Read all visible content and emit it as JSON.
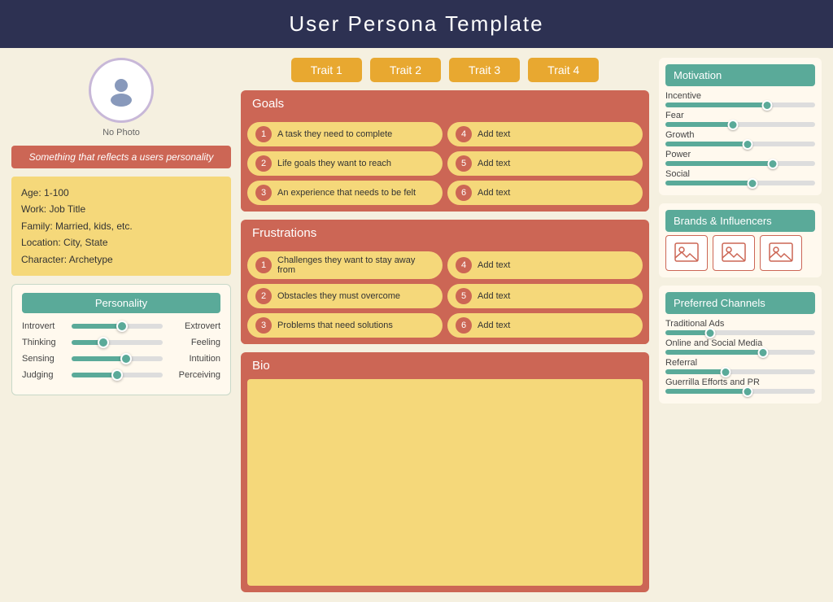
{
  "header": {
    "title": "User  Persona Template"
  },
  "avatar": {
    "no_photo": "No Photo"
  },
  "tagline": "Something that reflects a users personality",
  "bio": {
    "lines": [
      "Age: 1-100",
      "Work: Job Title",
      "Family:  Married, kids, etc.",
      "Location: City, State",
      "Character:  Archetype"
    ]
  },
  "personality": {
    "title": "Personality",
    "sliders": [
      {
        "left": "Introvert",
        "right": "Extrovert",
        "value": 55
      },
      {
        "left": "Thinking",
        "right": "Feeling",
        "value": 35
      },
      {
        "left": "Sensing",
        "right": "Intuition",
        "value": 60
      },
      {
        "left": "Judging",
        "right": "Perceiving",
        "value": 50
      }
    ]
  },
  "traits": [
    {
      "label": "Trait  1"
    },
    {
      "label": "Trait  2"
    },
    {
      "label": "Trait  3"
    },
    {
      "label": "Trait  4"
    }
  ],
  "goals": {
    "title": "Goals",
    "items": [
      {
        "num": "1",
        "text": "A task they need to complete"
      },
      {
        "num": "2",
        "text": "Life goals they want to reach"
      },
      {
        "num": "3",
        "text": "An experience that needs to be felt"
      },
      {
        "num": "4",
        "text": "Add text"
      },
      {
        "num": "5",
        "text": "Add text"
      },
      {
        "num": "6",
        "text": "Add text"
      }
    ]
  },
  "frustrations": {
    "title": "Frustrations",
    "items": [
      {
        "num": "1",
        "text": "Challenges they want to stay away from"
      },
      {
        "num": "2",
        "text": "Obstacles they must overcome"
      },
      {
        "num": "3",
        "text": "Problems that need solutions"
      },
      {
        "num": "4",
        "text": "Add text"
      },
      {
        "num": "5",
        "text": "Add text"
      },
      {
        "num": "6",
        "text": "Add text"
      }
    ]
  },
  "bio_section": {
    "title": "Bio"
  },
  "motivation": {
    "title": "Motivation",
    "sliders": [
      {
        "label": "Incentive",
        "value": 68
      },
      {
        "label": "Fear",
        "value": 45
      },
      {
        "label": "Growth",
        "value": 55
      },
      {
        "label": "Power",
        "value": 72
      },
      {
        "label": "Social",
        "value": 58
      }
    ]
  },
  "brands": {
    "title": "Brands & Influencers",
    "count": 3
  },
  "channels": {
    "title": "Preferred Channels",
    "sliders": [
      {
        "label": "Traditional Ads",
        "value": 30
      },
      {
        "label": "Online and Social Media",
        "value": 65
      },
      {
        "label": "Referral",
        "value": 40
      },
      {
        "label": "Guerrilla Efforts and PR",
        "value": 55
      }
    ]
  }
}
